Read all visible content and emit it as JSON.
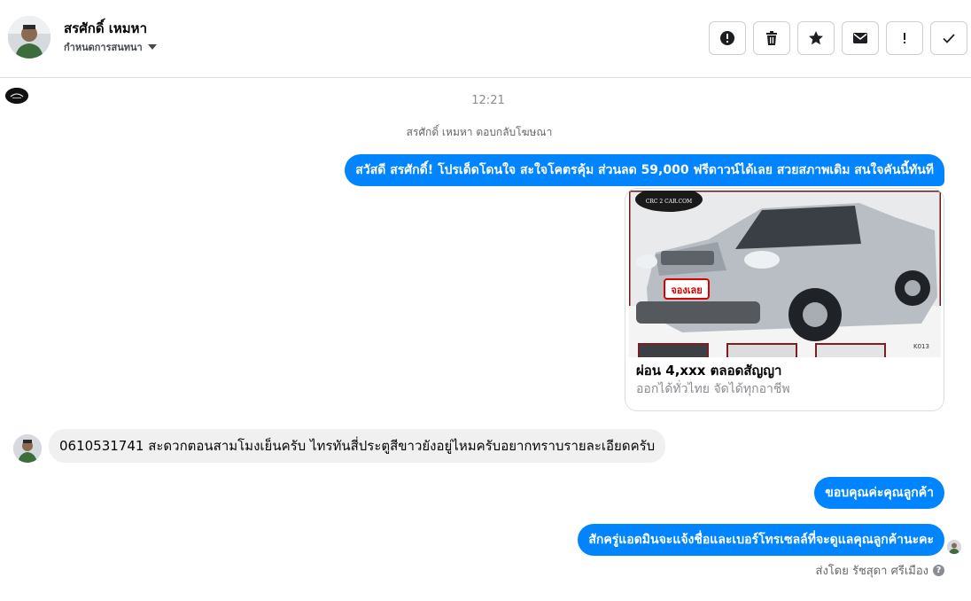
{
  "header": {
    "contact_name": "สรศักดิ์ เหมหา",
    "assign_label": "กำหนดการสนทนา"
  },
  "toolbar": {
    "buttons": [
      {
        "name": "spam",
        "icon": "alert-circle-icon"
      },
      {
        "name": "delete",
        "icon": "trash-icon"
      },
      {
        "name": "star",
        "icon": "star-icon"
      },
      {
        "name": "mark-unread",
        "icon": "envelope-icon"
      },
      {
        "name": "follow-up",
        "icon": "exclamation-icon"
      },
      {
        "name": "done",
        "icon": "check-icon"
      }
    ]
  },
  "conversation": {
    "timestamp": "12:21",
    "ad_reply_note": "สรศักดิ์ เหมหา ตอบกลับโฆษณา",
    "messages": [
      {
        "direction": "out",
        "text": "สวัสดี สรศักดิ์! โปรเด็ดโดนใจ สะใจโคตรคุ้ม ส่วนลด 59,000 ฟรีดาวน์ได้เลย สวยสภาพเดิม สนใจคันนี้ทันที"
      },
      {
        "direction": "in",
        "text": "0610531741   สะดวกตอนสามโมงเย็นครับ   ไทรทันสี่ประตูสีขาวยังอยู่ไหมครับอยากทราบรายละเอียดครับ"
      },
      {
        "direction": "out",
        "text": "ขอบคุณค่ะคุณลูกค้า"
      },
      {
        "direction": "out",
        "text": "สักครู่แอดมินจะแจ้งชื่อและเบอร์โทรเซลล์ที่จะดูแลคุณลูกค้านะคะ"
      }
    ],
    "ad_card": {
      "image_badge": "จองเลย",
      "watermark": "CRC 2 CAR.COM",
      "stock_code": "K013",
      "title": "ผ่อน 4,xxx ตลอดสัญญา",
      "subtitle": "ออกได้ทั่วไทย จัดได้ทุกอาชีพ"
    },
    "sent_by": "ส่งโดย รัชสุดา ศรีเมือง"
  },
  "colors": {
    "accent": "#0084ff",
    "incoming_bubble": "#f0f0f0"
  }
}
